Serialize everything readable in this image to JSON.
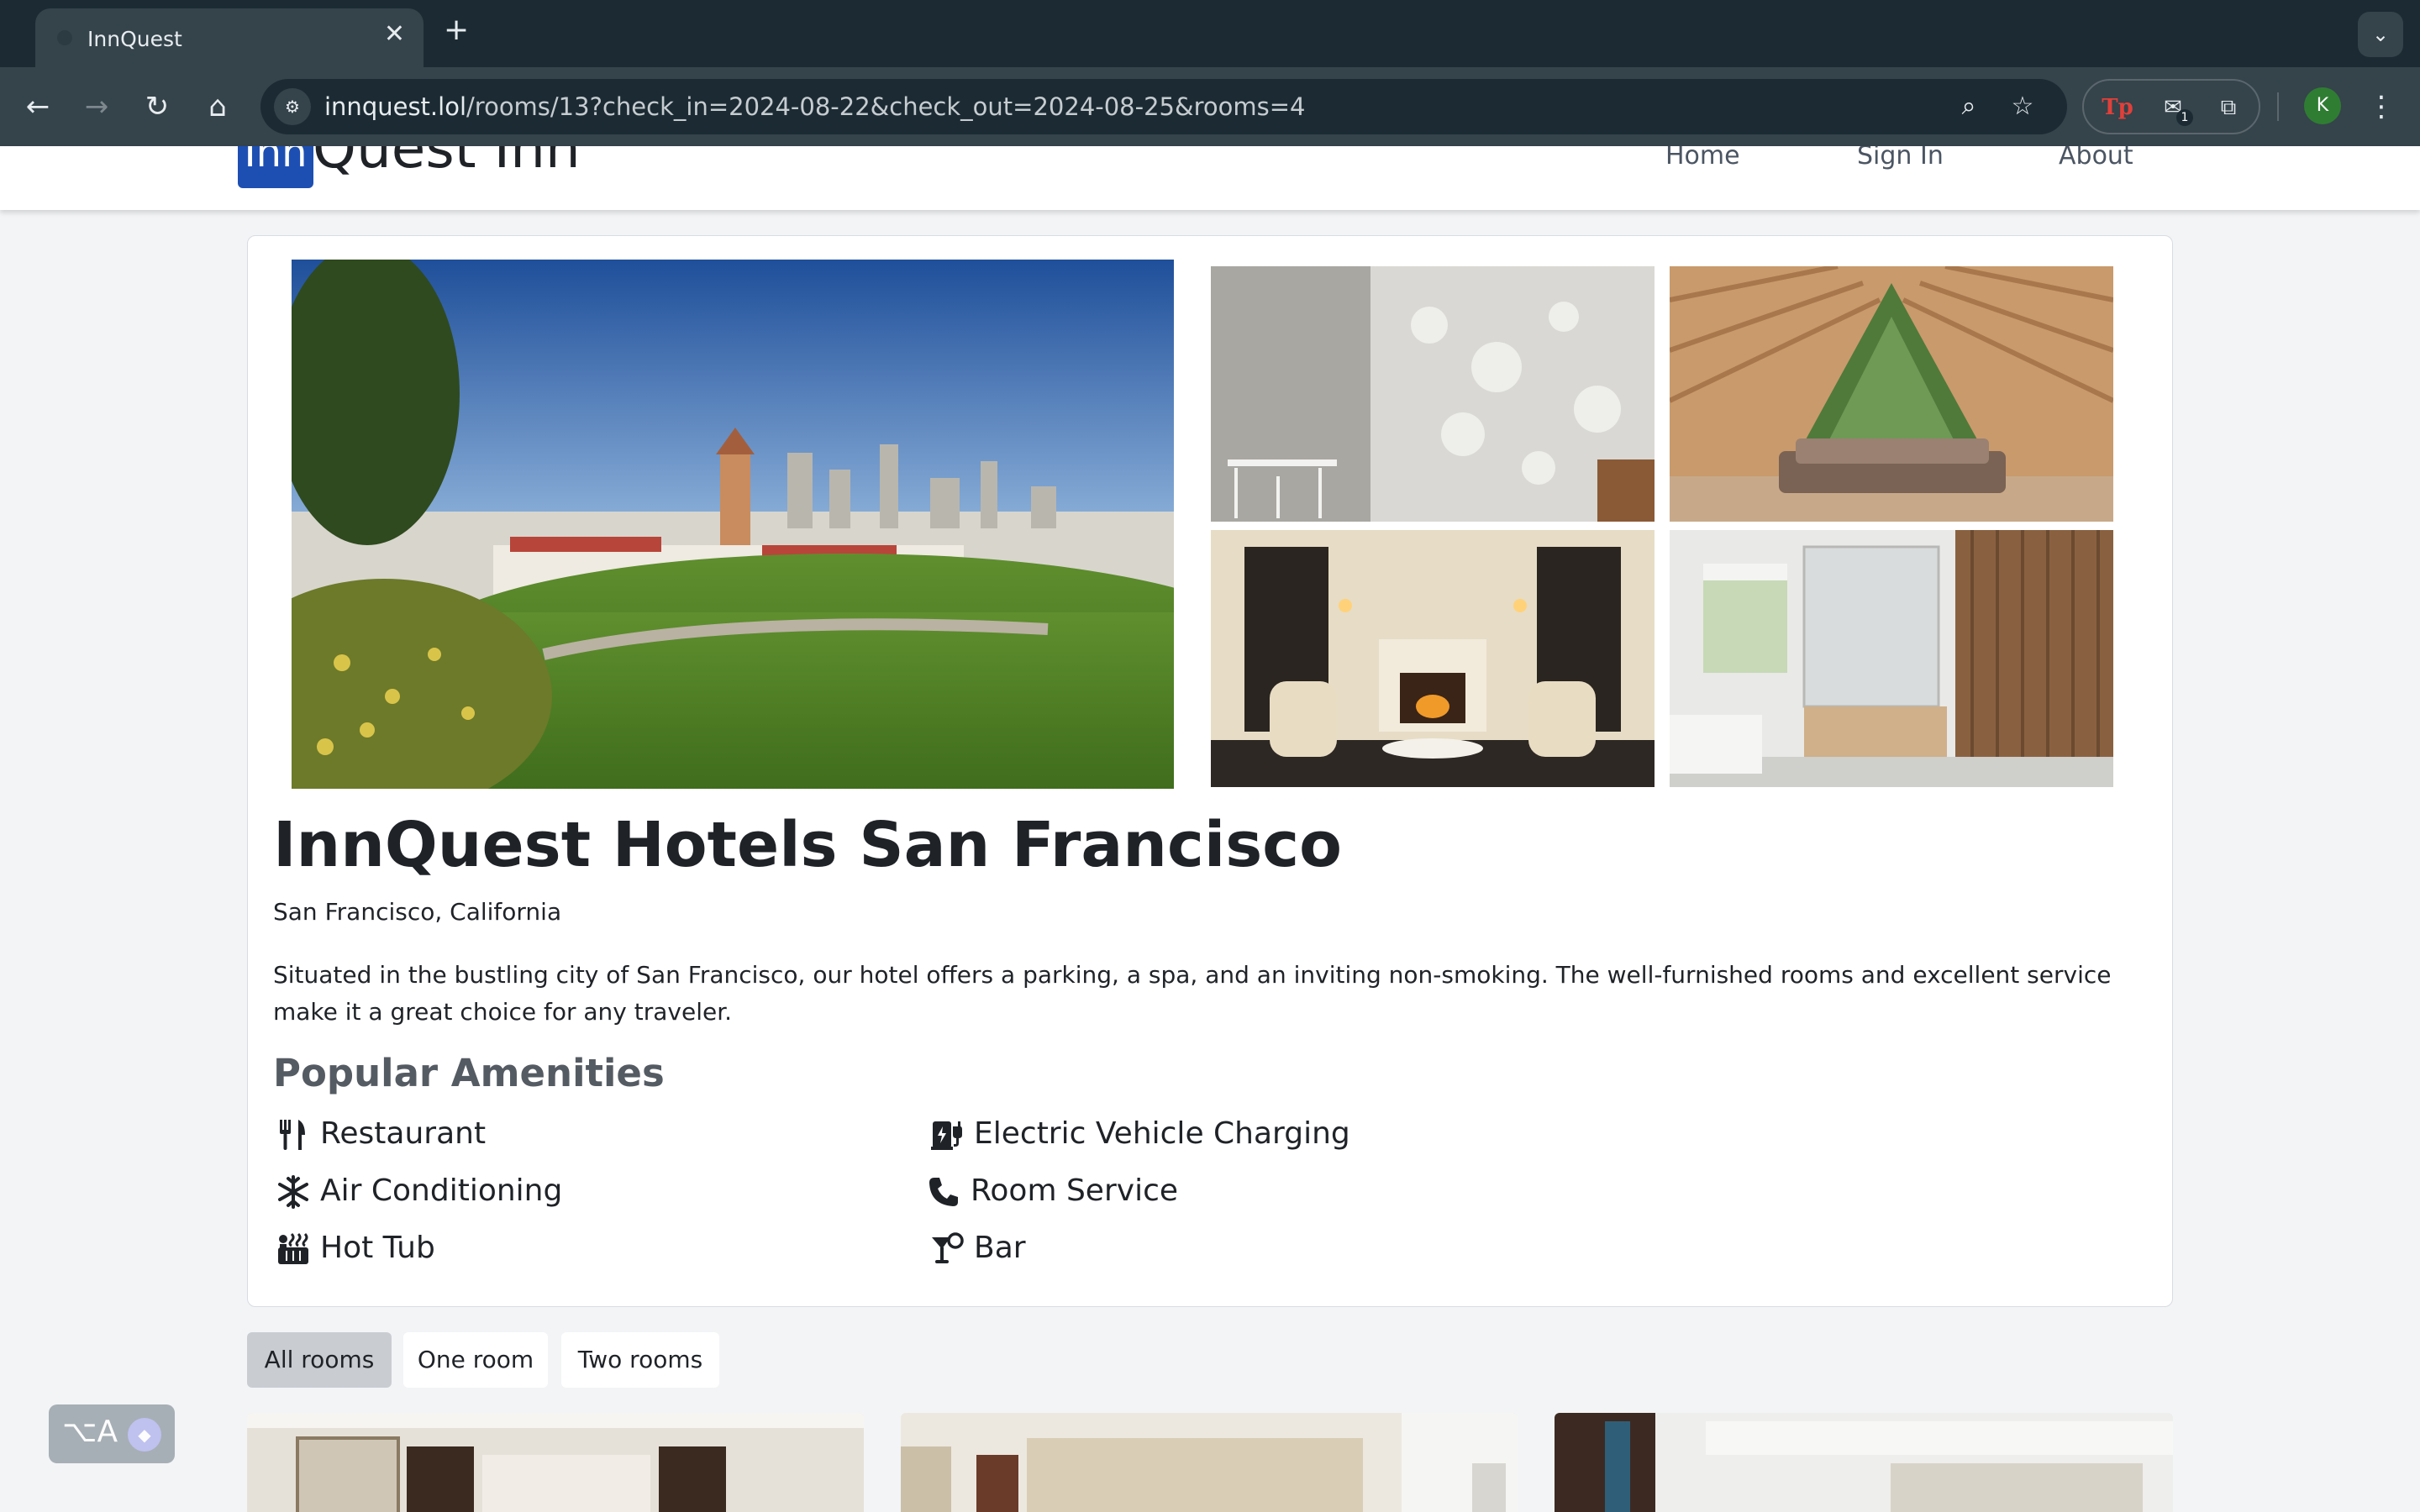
{
  "browser": {
    "tab_title": "InnQuest",
    "tab_close": "✕",
    "new_tab": "+",
    "tab_search": "⌄",
    "url_host": "innquest.lol",
    "url_path": "/rooms/13?check_in=2024-08-22&check_out=2024-08-25&rooms=4",
    "back": "←",
    "forward": "→",
    "reload": "↻",
    "home": "⌂",
    "zoom_icon": "⌕",
    "star_icon": "☆",
    "ext_tp": "Tp",
    "ext_badge": "1",
    "profile_initial": "K",
    "menu": "⋮"
  },
  "site": {
    "logo_mark": "Inn",
    "logo_text": "Quest Inn",
    "nav": [
      "Home",
      "Sign In",
      "About"
    ]
  },
  "hotel": {
    "name": "InnQuest Hotels San Francisco",
    "location": "San Francisco, California",
    "description": "Situated in the bustling city of San Francisco, our hotel offers a parking, a spa, and an inviting non-smoking. The well-furnished rooms and excellent service make it a great choice for any traveler.",
    "amenities_title": "Popular Amenities",
    "amenities": [
      {
        "label": "Restaurant",
        "icon": "utensils-icon"
      },
      {
        "label": "Electric Vehicle Charging",
        "icon": "ev-charging-icon"
      },
      {
        "label": "Air Conditioning",
        "icon": "snowflake-icon"
      },
      {
        "label": "Room Service",
        "icon": "phone-icon"
      },
      {
        "label": "Hot Tub",
        "icon": "hot-tub-icon"
      },
      {
        "label": "Bar",
        "icon": "cocktail-icon"
      }
    ]
  },
  "filters": [
    "All rooms",
    "One room",
    "Two rooms"
  ],
  "widget": {
    "text": "⌥A"
  },
  "colors": {
    "brand": "#1d4fb3",
    "chrome_dark": "#1c2b33",
    "chrome_mid": "#35434b",
    "active_filter": "#c9ccd1"
  }
}
